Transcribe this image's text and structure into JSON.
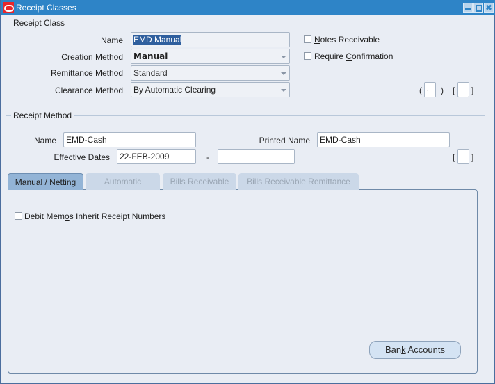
{
  "window": {
    "title": "Receipt Classes",
    "controls": {
      "minimize": "minimize",
      "maximize": "maximize",
      "close": "✖"
    }
  },
  "receipt_class": {
    "section_title": "Receipt Class",
    "name_label": "Name",
    "name_value": "EMD Manual",
    "creation_method_label": "Creation Method",
    "creation_method_value": "Manual",
    "remittance_method_label": "Remittance Method",
    "remittance_method_value": "Standard",
    "clearance_method_label": "Clearance Method",
    "clearance_method_value": "By Automatic Clearing",
    "notes_receivable": {
      "label_pre": "",
      "label_ul": "N",
      "label_post": "otes Receivable",
      "checked": false
    },
    "require_confirmation": {
      "label_pre": "Require ",
      "label_ul": "C",
      "label_post": "onfirmation",
      "checked": false
    },
    "context_field_value": ".",
    "paren_open": "(",
    "paren_close": ")",
    "bracket_open": "[",
    "bracket_close": "]"
  },
  "receipt_method": {
    "section_title": "Receipt Method",
    "name_label": "Name",
    "name_value": "EMD-Cash",
    "printed_name_label": "Printed Name",
    "printed_name_value": "EMD-Cash",
    "effective_dates_label": "Effective Dates",
    "effective_from": "22-FEB-2009",
    "date_separator": "-",
    "effective_to": "",
    "bracket_open": "[",
    "bracket_close": "]"
  },
  "tabs": [
    {
      "label": "Manual / Netting",
      "active": true
    },
    {
      "label": "Automatic",
      "active": false
    },
    {
      "label": "Bills Receivable",
      "active": false
    },
    {
      "label": "Bills Receivable Remittance",
      "active": false
    }
  ],
  "manual_netting": {
    "debit_memos": {
      "label_pre": "Debit Mem",
      "label_ul": "o",
      "label_post": "s Inherit Receipt Numbers",
      "checked": false
    },
    "bank_accounts_button": {
      "label_pre": "Ban",
      "label_ul": "k",
      "label_post": " Accounts"
    }
  }
}
